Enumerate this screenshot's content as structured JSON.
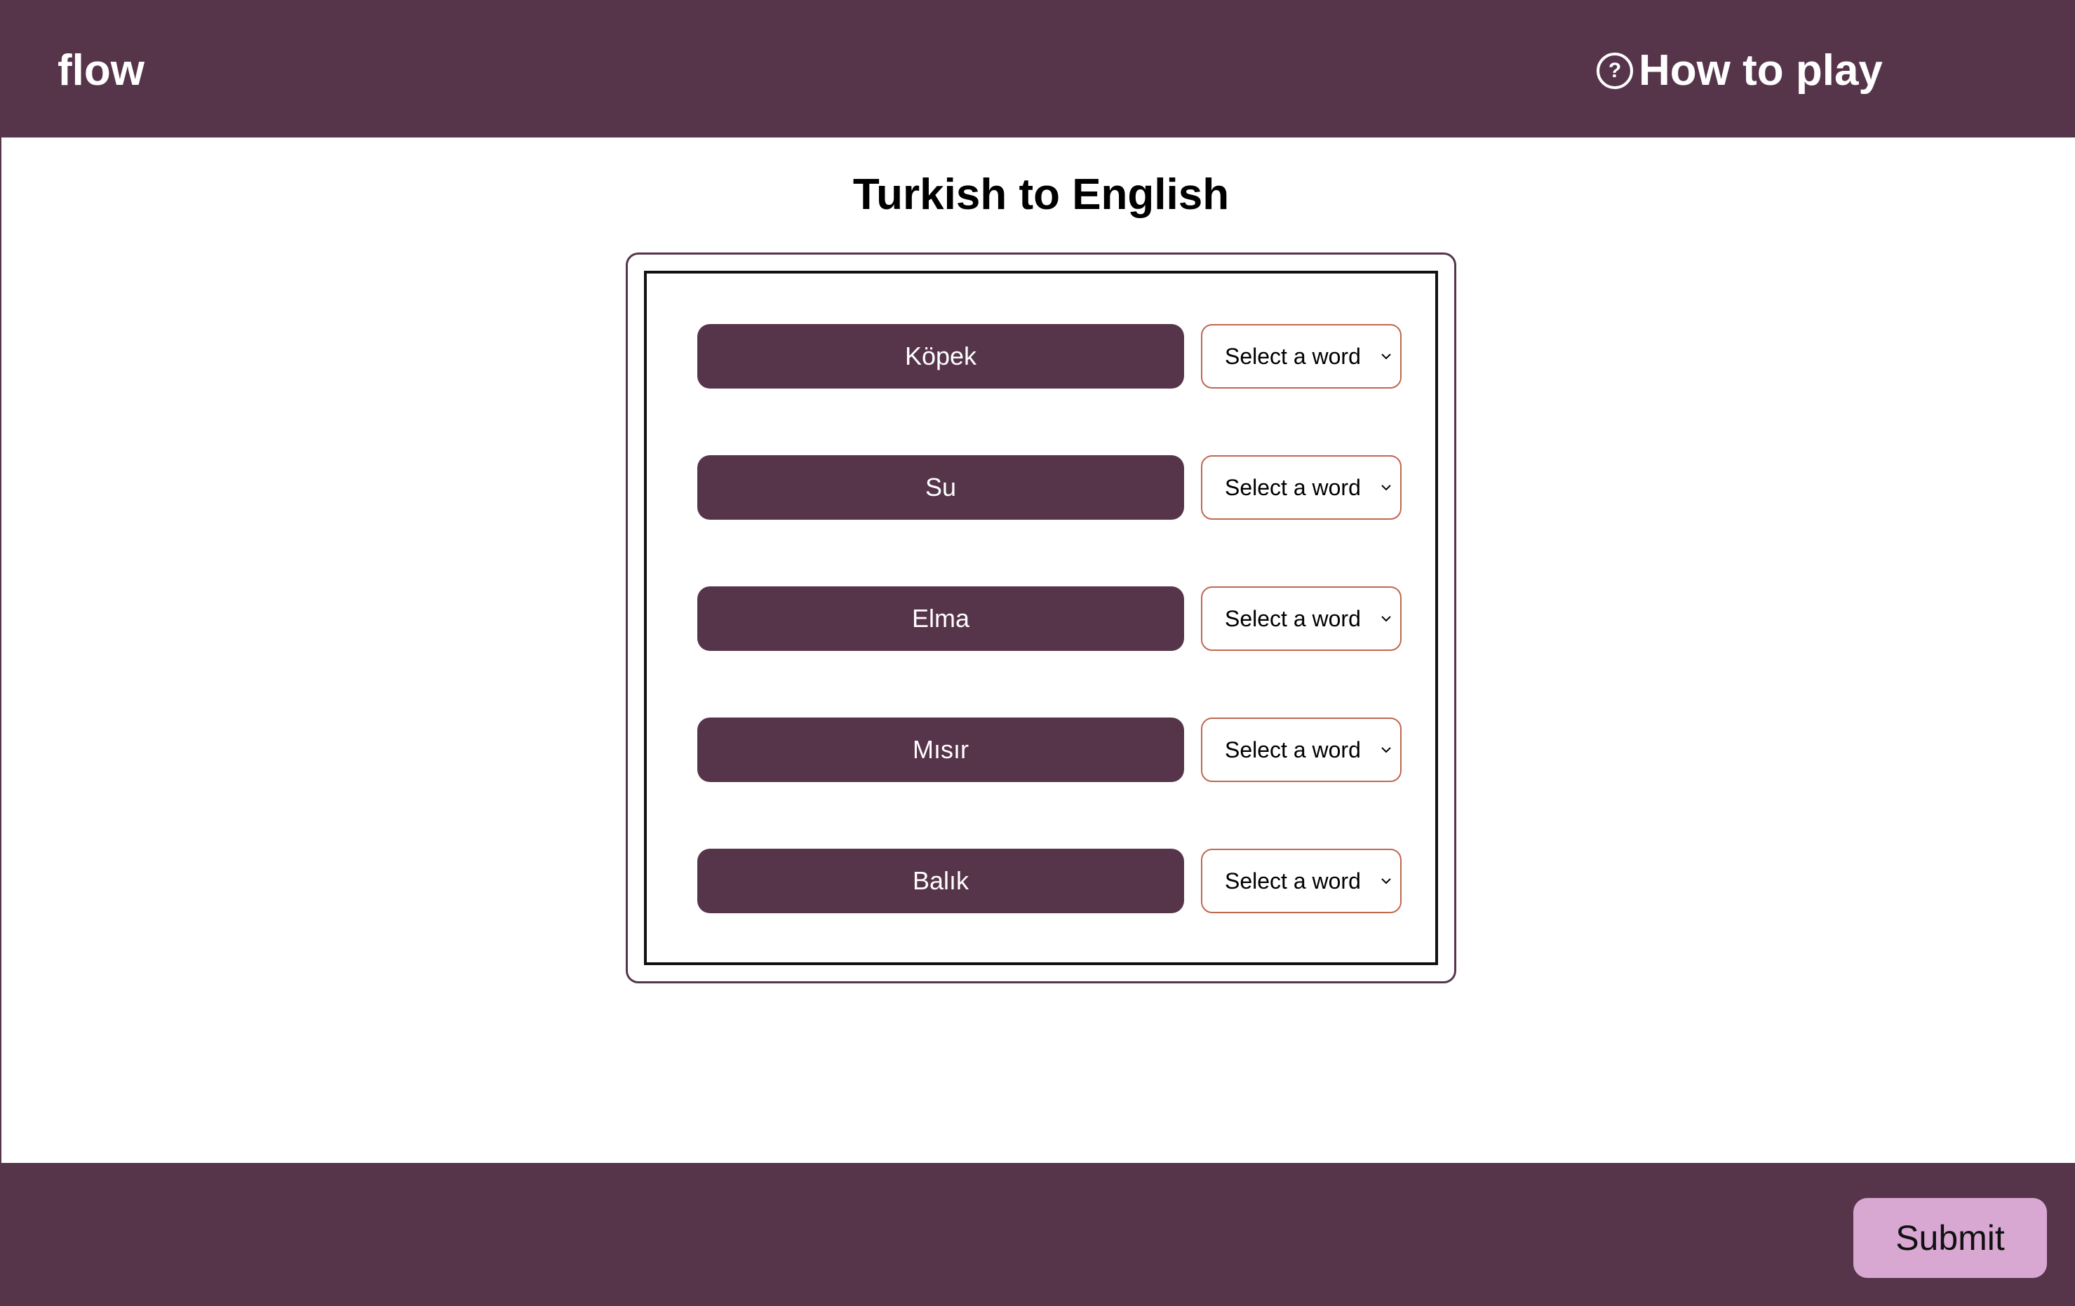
{
  "header": {
    "brand": "flow",
    "help_label": "How to play",
    "help_icon_glyph": "?",
    "icon": "question-circle-icon"
  },
  "main": {
    "title": "Turkish to English",
    "rows": [
      {
        "word": "Köpek",
        "select_value": "Select a word"
      },
      {
        "word": "Su",
        "select_value": "Select a word"
      },
      {
        "word": "Elma",
        "select_value": "Select a word"
      },
      {
        "word": "Mısır",
        "select_value": "Select a word"
      },
      {
        "word": "Balık",
        "select_value": "Select a word"
      }
    ]
  },
  "footer": {
    "submit_label": "Submit"
  },
  "colors": {
    "brand": "#56354b",
    "submit_bg": "#d8a7d2",
    "select_border": "#c0674f"
  }
}
